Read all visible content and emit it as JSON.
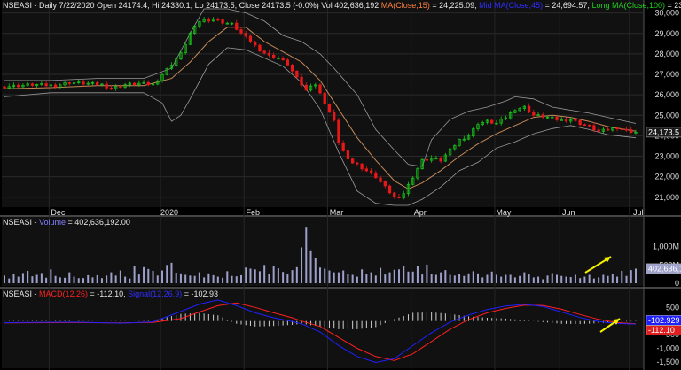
{
  "header": {
    "prefix": "NSEASI - Daily 7/22/2020 Open 24174.4, Hi 24330.1, Lo 24173.5, Close 24173.5 (-0.0%) Vol 402,636,192 ",
    "ma_label": "MA(Close,15)",
    "ma_value": " = 24,225.09, ",
    "mid_label": "Mid MA(Close,45)",
    "mid_value": " = 24,694.57, ",
    "long_label": "Long MA(Close,100)",
    "long_value": " = 23,85"
  },
  "volume_header": {
    "prefix": "NSEASI - ",
    "label": "Volume",
    "value": " = 402,636,192.00"
  },
  "macd_header": {
    "prefix": "NSEASI - ",
    "macd_label": "MACD(12,26)",
    "macd_value": " = -112.10, ",
    "signal_label": "Signal(12,26,9)",
    "signal_value": " = -102.93"
  },
  "colors": {
    "background": "#000000",
    "panel_bg": "#111111",
    "up": "#18c818",
    "down": "#e81818",
    "ma": "#c48a5a",
    "bands": "#9a9a9a",
    "volume": "#9ea0cc",
    "macd": "#2020ff",
    "signal": "#ff2020",
    "histogram": "#cfcfcf",
    "arrow": "#f0f000",
    "ma_text": "#ff8040",
    "mid_text": "#2f2fff",
    "long_text": "#20d020",
    "macd_text": "#ff2020",
    "signal_text": "#3030ff",
    "volume_text": "#8080ff"
  },
  "chart_data": [
    {
      "type": "candlestick",
      "title": "NSEASI - Daily",
      "y_ticks": [
        "30,000",
        "29,000",
        "28,000",
        "27,000",
        "26,000",
        "25,000",
        "24,000",
        "23,000",
        "22,000",
        "21,000"
      ],
      "ylim": [
        20600,
        30200
      ],
      "x_labels": [
        "Dec",
        "2020",
        "Feb",
        "Mar",
        "Apr",
        "May",
        "Jun",
        "Jul"
      ],
      "last_price_label": "24,173.5",
      "close_path": [
        [
          0,
          26400
        ],
        [
          6,
          26500
        ],
        [
          11,
          26450
        ],
        [
          14,
          26600
        ],
        [
          18,
          26550
        ],
        [
          21,
          26500
        ],
        [
          23,
          26300
        ],
        [
          26,
          26500
        ],
        [
          29,
          26550
        ],
        [
          32,
          26500
        ],
        [
          34,
          27000
        ],
        [
          36,
          27500
        ],
        [
          38,
          28000
        ],
        [
          40,
          29000
        ],
        [
          42,
          29600
        ],
        [
          45,
          29700
        ],
        [
          47,
          29550
        ],
        [
          49,
          29450
        ],
        [
          51,
          29000
        ],
        [
          53,
          28600
        ],
        [
          55,
          28200
        ],
        [
          57,
          27900
        ],
        [
          59,
          27800
        ],
        [
          61,
          27500
        ],
        [
          63,
          26800
        ],
        [
          65,
          26200
        ],
        [
          66,
          26500
        ],
        [
          67,
          26500
        ],
        [
          69,
          25600
        ],
        [
          71,
          24700
        ],
        [
          72,
          23700
        ],
        [
          74,
          22800
        ],
        [
          76,
          22600
        ],
        [
          78,
          22300
        ],
        [
          80,
          22000
        ],
        [
          82,
          21500
        ],
        [
          84,
          21000
        ],
        [
          85,
          20900
        ],
        [
          86,
          21200
        ],
        [
          88,
          22000
        ],
        [
          90,
          22800
        ],
        [
          92,
          22900
        ],
        [
          94,
          22800
        ],
        [
          96,
          23300
        ],
        [
          98,
          23800
        ],
        [
          100,
          24000
        ],
        [
          102,
          24600
        ],
        [
          104,
          24700
        ],
        [
          106,
          24600
        ],
        [
          108,
          24900
        ],
        [
          110,
          25300
        ],
        [
          112,
          25400
        ],
        [
          114,
          25000
        ],
        [
          116,
          24950
        ],
        [
          118,
          24850
        ],
        [
          120,
          24750
        ],
        [
          122,
          24800
        ],
        [
          124,
          24600
        ],
        [
          126,
          24450
        ],
        [
          128,
          24200
        ],
        [
          130,
          24300
        ],
        [
          132,
          24400
        ],
        [
          134,
          24250
        ],
        [
          136,
          24173.5
        ]
      ],
      "ma15": [
        [
          0,
          26300
        ],
        [
          10,
          26350
        ],
        [
          20,
          26450
        ],
        [
          30,
          26450
        ],
        [
          36,
          26800
        ],
        [
          40,
          27600
        ],
        [
          44,
          28600
        ],
        [
          48,
          29300
        ],
        [
          52,
          29300
        ],
        [
          56,
          28600
        ],
        [
          60,
          28100
        ],
        [
          64,
          27600
        ],
        [
          68,
          26700
        ],
        [
          72,
          25300
        ],
        [
          76,
          23900
        ],
        [
          80,
          22800
        ],
        [
          84,
          21800
        ],
        [
          87,
          21400
        ],
        [
          90,
          21700
        ],
        [
          94,
          22300
        ],
        [
          98,
          23000
        ],
        [
          102,
          23600
        ],
        [
          106,
          24100
        ],
        [
          110,
          24500
        ],
        [
          114,
          24900
        ],
        [
          118,
          25000
        ],
        [
          122,
          24900
        ],
        [
          126,
          24700
        ],
        [
          130,
          24450
        ],
        [
          136,
          24225
        ]
      ],
      "upper_band": [
        [
          0,
          26700
        ],
        [
          10,
          26700
        ],
        [
          20,
          26800
        ],
        [
          30,
          26800
        ],
        [
          36,
          27300
        ],
        [
          40,
          29000
        ],
        [
          43,
          30200
        ],
        [
          48,
          30200
        ],
        [
          52,
          30000
        ],
        [
          56,
          29600
        ],
        [
          60,
          28900
        ],
        [
          64,
          28600
        ],
        [
          68,
          28000
        ],
        [
          71,
          27300
        ],
        [
          76,
          26000
        ],
        [
          80,
          24300
        ],
        [
          84,
          23300
        ],
        [
          87,
          22600
        ],
        [
          90,
          22500
        ],
        [
          92,
          23800
        ],
        [
          96,
          24800
        ],
        [
          100,
          25200
        ],
        [
          104,
          25400
        ],
        [
          108,
          25700
        ],
        [
          110,
          25900
        ],
        [
          114,
          25800
        ],
        [
          118,
          25400
        ],
        [
          122,
          25250
        ],
        [
          126,
          25100
        ],
        [
          130,
          24900
        ],
        [
          136,
          24600
        ]
      ],
      "lower_band": [
        [
          0,
          25900
        ],
        [
          10,
          26100
        ],
        [
          20,
          26100
        ],
        [
          30,
          26100
        ],
        [
          34,
          25600
        ],
        [
          36,
          24700
        ],
        [
          38,
          25000
        ],
        [
          40,
          25800
        ],
        [
          44,
          27500
        ],
        [
          48,
          28300
        ],
        [
          52,
          28200
        ],
        [
          56,
          27800
        ],
        [
          60,
          27400
        ],
        [
          64,
          26600
        ],
        [
          68,
          25300
        ],
        [
          72,
          23200
        ],
        [
          76,
          21300
        ],
        [
          80,
          20700
        ],
        [
          84,
          20600
        ],
        [
          87,
          20600
        ],
        [
          90,
          20900
        ],
        [
          94,
          21500
        ],
        [
          98,
          22300
        ],
        [
          102,
          22700
        ],
        [
          106,
          23400
        ],
        [
          110,
          23700
        ],
        [
          114,
          24100
        ],
        [
          118,
          24350
        ],
        [
          122,
          24500
        ],
        [
          126,
          24300
        ],
        [
          130,
          24050
        ],
        [
          136,
          23900
        ]
      ]
    },
    {
      "type": "bar",
      "title": "Volume",
      "y_ticks": [
        "1,000M",
        "500M",
        "0"
      ],
      "ylim": [
        0,
        1500
      ],
      "last_value_label": "402,636,1",
      "values": [
        210,
        130,
        250,
        180,
        280,
        340,
        190,
        230,
        280,
        150,
        380,
        200,
        160,
        150,
        300,
        180,
        140,
        140,
        220,
        160,
        220,
        140,
        210,
        300,
        210,
        350,
        180,
        130,
        460,
        240,
        440,
        390,
        340,
        210,
        350,
        500,
        560,
        290,
        270,
        230,
        210,
        200,
        300,
        160,
        270,
        220,
        180,
        150,
        330,
        200,
        190,
        220,
        430,
        400,
        380,
        330,
        500,
        260,
        470,
        410,
        310,
        260,
        360,
        440,
        980,
        1520,
        900,
        680,
        430,
        400,
        350,
        300,
        300,
        350,
        260,
        230,
        180,
        380,
        250,
        300,
        210,
        420,
        240,
        300,
        370,
        380,
        460,
        320,
        320,
        480,
        240,
        510,
        250,
        230,
        300,
        360,
        230,
        210,
        260,
        200,
        270,
        330,
        270,
        160,
        230,
        320,
        230,
        180,
        230,
        230,
        160,
        200,
        300,
        240,
        160,
        180,
        110,
        210,
        280,
        230,
        200,
        180,
        170,
        230,
        140,
        180,
        230,
        130,
        160,
        230,
        200,
        250,
        180,
        340,
        200,
        360,
        400
      ]
    },
    {
      "type": "line",
      "title": "MACD",
      "y_ticks": [
        "500",
        "0",
        "-500",
        "-1,000",
        "-1,500"
      ],
      "ylim": [
        -1600,
        800
      ],
      "series": [
        {
          "name": "MACD(12,26)",
          "points": [
            [
              0,
              -60
            ],
            [
              15,
              -40
            ],
            [
              25,
              -80
            ],
            [
              32,
              -30
            ],
            [
              38,
              350
            ],
            [
              42,
              620
            ],
            [
              46,
              770
            ],
            [
              50,
              560
            ],
            [
              54,
              300
            ],
            [
              58,
              120
            ],
            [
              62,
              -20
            ],
            [
              64,
              -100
            ],
            [
              68,
              -400
            ],
            [
              72,
              -900
            ],
            [
              76,
              -1300
            ],
            [
              80,
              -1520
            ],
            [
              84,
              -1380
            ],
            [
              88,
              -900
            ],
            [
              92,
              -430
            ],
            [
              96,
              -40
            ],
            [
              100,
              220
            ],
            [
              104,
              420
            ],
            [
              108,
              550
            ],
            [
              112,
              610
            ],
            [
              116,
              530
            ],
            [
              120,
              330
            ],
            [
              124,
              130
            ],
            [
              128,
              -20
            ],
            [
              132,
              -90
            ],
            [
              136,
              -112.1
            ]
          ]
        },
        {
          "name": "Signal(12,26,9)",
          "points": [
            [
              0,
              -70
            ],
            [
              15,
              -55
            ],
            [
              25,
              -70
            ],
            [
              32,
              -50
            ],
            [
              38,
              90
            ],
            [
              42,
              330
            ],
            [
              46,
              560
            ],
            [
              50,
              660
            ],
            [
              54,
              500
            ],
            [
              58,
              300
            ],
            [
              62,
              120
            ],
            [
              64,
              0
            ],
            [
              68,
              -200
            ],
            [
              72,
              -600
            ],
            [
              76,
              -1000
            ],
            [
              80,
              -1300
            ],
            [
              84,
              -1450
            ],
            [
              88,
              -1200
            ],
            [
              92,
              -750
            ],
            [
              96,
              -300
            ],
            [
              100,
              50
            ],
            [
              104,
              300
            ],
            [
              108,
              460
            ],
            [
              112,
              580
            ],
            [
              116,
              570
            ],
            [
              120,
              430
            ],
            [
              124,
              240
            ],
            [
              128,
              60
            ],
            [
              132,
              -60
            ],
            [
              136,
              -102.93
            ]
          ]
        }
      ],
      "last_value_labels": [
        "-102.929",
        "-112.10"
      ]
    }
  ]
}
